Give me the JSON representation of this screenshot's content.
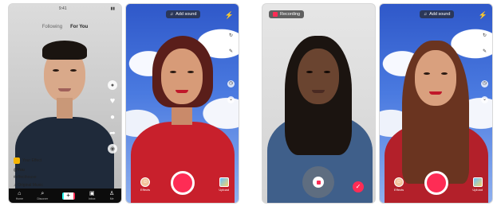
{
  "screens": {
    "feed": {
      "status_time": "9:41",
      "tabs": [
        "Following",
        "For You"
      ],
      "effect_label": "Your Effect",
      "username": "@You",
      "hashtag": "#effecthouse",
      "music": "Original Music",
      "nav": [
        "Home",
        "Discover",
        "",
        "Inbox",
        "Me"
      ]
    },
    "camera_1": {
      "add_sound": "Add sound",
      "effects_label": "Effects",
      "upload_label": "Upload"
    },
    "recording": {
      "recording_label": "Recording"
    },
    "camera_2": {
      "add_sound": "Add sound",
      "effects_label": "Effects",
      "upload_label": "Upload"
    }
  },
  "colors": {
    "accent": "#fe2c55",
    "cyan": "#25f4ee",
    "sky": "#4a7ae0"
  },
  "icons": [
    "music-note-icon",
    "flash-icon",
    "flip-icon",
    "timer-icon",
    "home-icon",
    "search-icon",
    "plus-icon",
    "inbox-icon",
    "profile-icon",
    "heart-icon",
    "comment-icon",
    "share-icon",
    "check-icon",
    "stop-icon"
  ]
}
